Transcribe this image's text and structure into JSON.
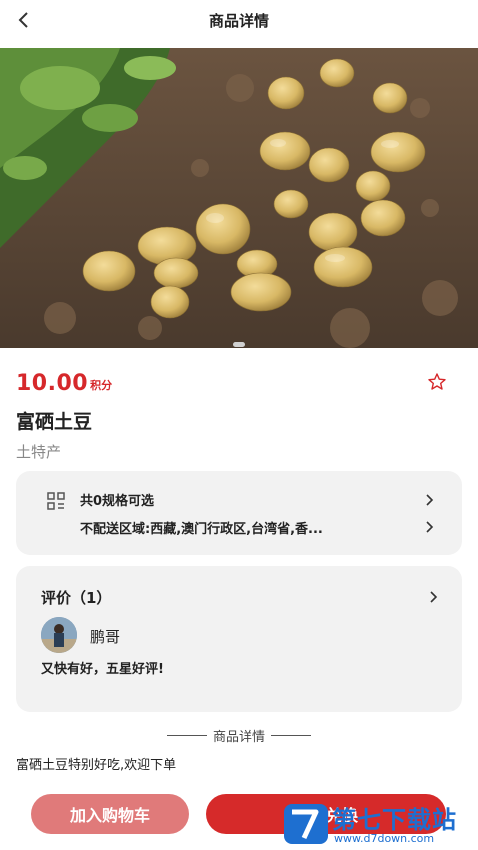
{
  "header": {
    "title": "商品详情"
  },
  "product": {
    "price": "10.00",
    "price_unit": "积分",
    "name": "富硒土豆",
    "category": "土特产"
  },
  "specs": {
    "options": "共0规格可选",
    "no_delivery": "不配送区域:西藏,澳门行政区,台湾省,香..."
  },
  "review": {
    "title": "评价（1）",
    "reviewer": "鹏哥",
    "text": "又快有好，五星好评!"
  },
  "details": {
    "section_label": "商品详情",
    "description": "富硒土豆特别好吃,欢迎下单"
  },
  "actions": {
    "add_cart": "加入购物车",
    "redeem": "立即兑换"
  },
  "watermark": {
    "title": "第七下载站",
    "url": "www.d7down.com"
  },
  "colors": {
    "accent": "#d6282b",
    "card_bg": "#f2f2f2",
    "cart_button": "#e07a7a"
  }
}
